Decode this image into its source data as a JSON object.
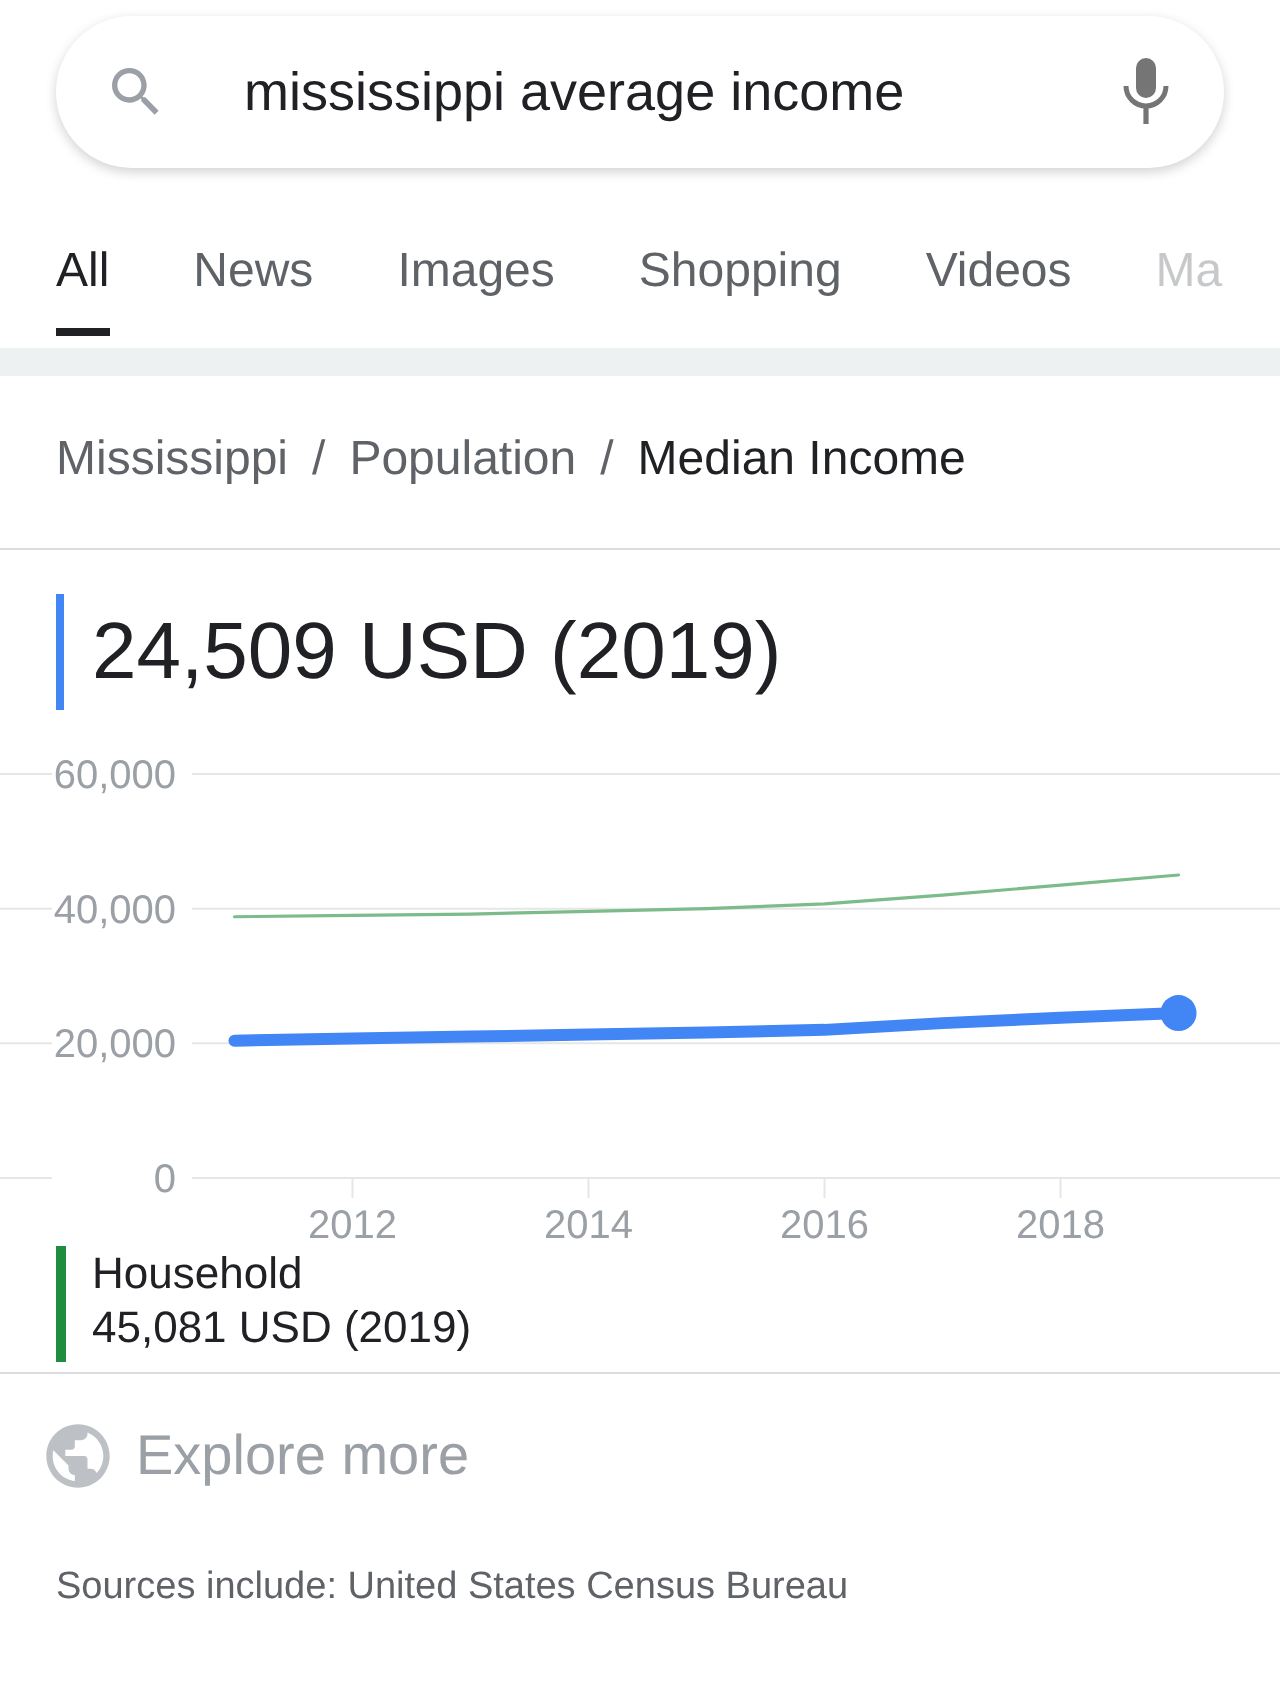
{
  "search": {
    "value": "mississippi average income"
  },
  "tabs": [
    {
      "label": "All",
      "selected": true
    },
    {
      "label": "News",
      "selected": false
    },
    {
      "label": "Images",
      "selected": false
    },
    {
      "label": "Shopping",
      "selected": false
    },
    {
      "label": "Videos",
      "selected": false
    },
    {
      "label": "Ma",
      "selected": false
    }
  ],
  "breadcrumb": [
    {
      "label": "Mississippi",
      "current": false
    },
    {
      "label": "Population",
      "current": false
    },
    {
      "label": "Median Income",
      "current": true
    }
  ],
  "breadcrumb_separator": "/",
  "headline": {
    "value": "24,509 USD (2019)",
    "color": "#4285f4"
  },
  "chart_data": {
    "type": "line",
    "x": [
      2011,
      2012,
      2013,
      2014,
      2015,
      2016,
      2017,
      2018,
      2019
    ],
    "xlim": [
      2010.64,
      2019.86
    ],
    "ylim": [
      0,
      60000
    ],
    "xticks": [
      2012,
      2014,
      2016,
      2018
    ],
    "yticks": [
      {
        "value": 0,
        "label": "0"
      },
      {
        "value": 20000,
        "label": "20,000"
      },
      {
        "value": 40000,
        "label": "40,000"
      },
      {
        "value": 60000,
        "label": "60,000"
      }
    ],
    "series": [
      {
        "color": "#7cbb8a",
        "values": [
          38800,
          39000,
          39200,
          39600,
          40000,
          40700,
          42000,
          43500,
          45000
        ]
      },
      {
        "color": "#4285f4",
        "values": [
          20400,
          20700,
          21000,
          21300,
          21600,
          22000,
          23000,
          23800,
          24500
        ]
      }
    ]
  },
  "legend": [
    {
      "label": "Household",
      "value": "45,081 USD (2019)",
      "color": "#1e8e3e"
    }
  ],
  "explore": {
    "label": "Explore more"
  },
  "sources": "Sources include: United States Census Bureau"
}
